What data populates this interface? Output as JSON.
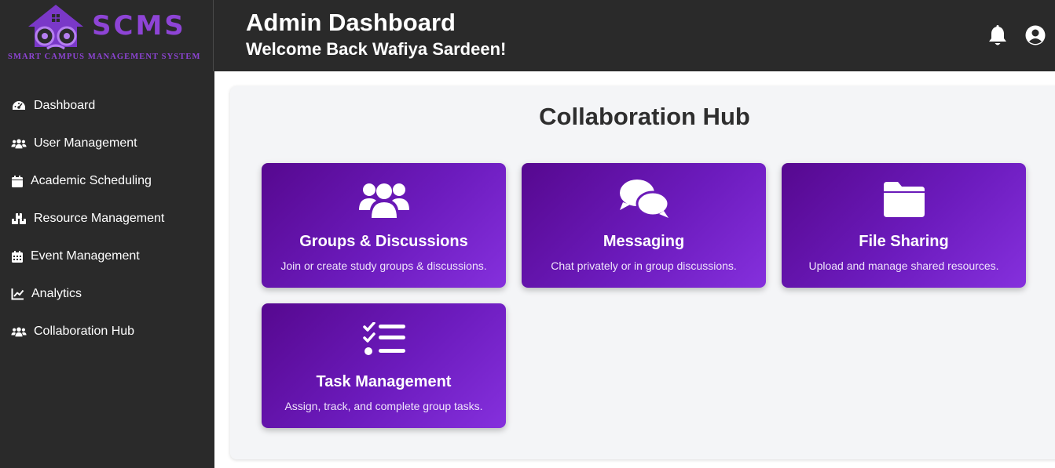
{
  "brand": {
    "name": "SCMS",
    "tagline": "SMART CAMPUS MANAGEMENT SYSTEM",
    "accent": "#8e44d6"
  },
  "header": {
    "title": "Admin Dashboard",
    "welcome": "Welcome Back Wafiya Sardeen!",
    "icons": [
      "bell-icon",
      "user-circle-icon"
    ]
  },
  "sidebar": {
    "items": [
      {
        "label": "Dashboard",
        "icon": "gauge-icon"
      },
      {
        "label": "User Management",
        "icon": "users-icon"
      },
      {
        "label": "Academic Scheduling",
        "icon": "calendar-icon"
      },
      {
        "label": "Resource Management",
        "icon": "boxes-icon"
      },
      {
        "label": "Event Management",
        "icon": "calendar-days-icon"
      },
      {
        "label": "Analytics",
        "icon": "line-chart-icon"
      },
      {
        "label": "Collaboration Hub",
        "icon": "users-icon"
      }
    ]
  },
  "main": {
    "title": "Collaboration Hub",
    "cards": [
      {
        "title": "Groups & Discussions",
        "description": "Join or create study groups & discussions.",
        "icon": "users-icon"
      },
      {
        "title": "Messaging",
        "description": "Chat privately or in group discussions.",
        "icon": "comments-icon"
      },
      {
        "title": "File Sharing",
        "description": "Upload and manage shared resources.",
        "icon": "folder-icon"
      },
      {
        "title": "Task Management",
        "description": "Assign, track, and complete group tasks.",
        "icon": "list-check-icon"
      }
    ]
  },
  "colors": {
    "header_bg": "#2a2a2a",
    "sidebar_bg": "#2a2a2a",
    "panel_bg": "#f4f5f7",
    "card_gradient_start": "#56088f",
    "card_gradient_end": "#8530dd"
  }
}
